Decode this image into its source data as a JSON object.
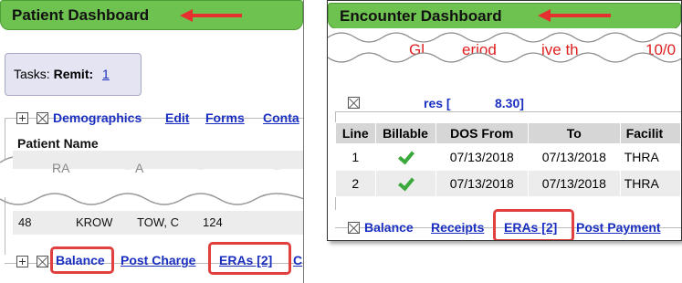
{
  "left": {
    "title": "Patient Dashboard",
    "tasks": {
      "label": "Tasks:",
      "type": "Remit",
      "separator": ":",
      "count": "1"
    },
    "demographics": {
      "label": "Demographics",
      "edit": "Edit",
      "forms": "Forms",
      "contacts": "Conta"
    },
    "patient_name_label": "Patient Name",
    "partial_text_1": "RA",
    "partial_text_2": "A",
    "address_fragments": {
      "a": "48",
      "b": "KROW",
      "c": "TOW, C",
      "d": "124"
    },
    "bottom": {
      "balance": "Balance",
      "post_charge": "Post Charge",
      "eras": "ERAs [2]",
      "cut": "C"
    }
  },
  "right": {
    "title": "Encounter Dashboard",
    "red_banner": {
      "a": "Gl",
      "b": "eriod",
      "c": "ive th",
      "d": "10/0"
    },
    "procedures_fragments": {
      "a": "res [",
      "b": "8.30]"
    },
    "table": {
      "headers": [
        "Line",
        "Billable",
        "DOS From",
        "To",
        "Facilit"
      ],
      "rows": [
        {
          "line": "1",
          "dos_from": "07/13/2018",
          "to": "07/13/2018",
          "facility": "THRA"
        },
        {
          "line": "2",
          "dos_from": "07/13/2018",
          "to": "07/13/2018",
          "facility": "THRA"
        }
      ]
    },
    "bottom": {
      "balance": "Balance",
      "receipts": "Receipts",
      "eras": "ERAs [2]",
      "post_payment": "Post Payment"
    }
  },
  "colors": {
    "header_green": "#6ec24f",
    "arrow_red": "#e63030",
    "link_blue": "#1a2fc0",
    "highlight_red": "#e04040",
    "banner_red": "#e02020"
  }
}
